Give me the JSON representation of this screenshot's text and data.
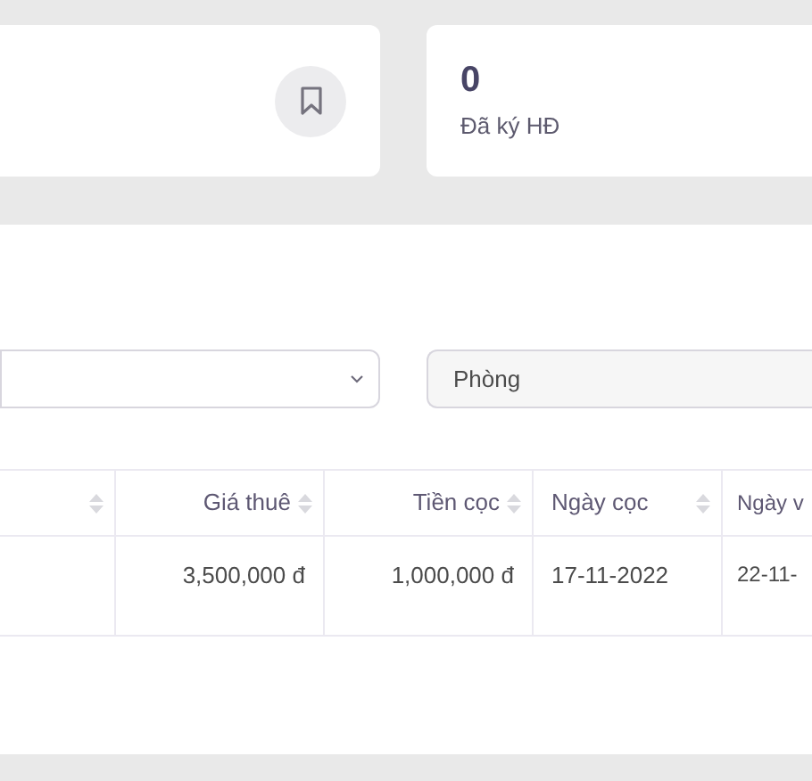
{
  "stat_cards": [
    {
      "kind": "icon"
    },
    {
      "kind": "count",
      "value": "0",
      "label": "Đã ký HĐ"
    }
  ],
  "filters": [
    {
      "kind": "select"
    },
    {
      "kind": "input",
      "placeholder": "Phòng"
    }
  ],
  "table": {
    "columns": [
      {
        "kind": "numeric",
        "sortable": true
      },
      {
        "label": "Giá thuê",
        "kind": "numeric",
        "sortable": true
      },
      {
        "label": "Tiền cọc",
        "kind": "numeric",
        "sortable": true
      },
      {
        "label": "Ngày cọc",
        "kind": "text",
        "sortable": true
      },
      {
        "label": "Ngày v",
        "kind": "text",
        "sortable": false
      }
    ],
    "rows": [
      [
        "",
        "3,500,000 đ",
        "1,000,000 đ",
        "17-11-2022",
        "22-11-"
      ]
    ]
  }
}
